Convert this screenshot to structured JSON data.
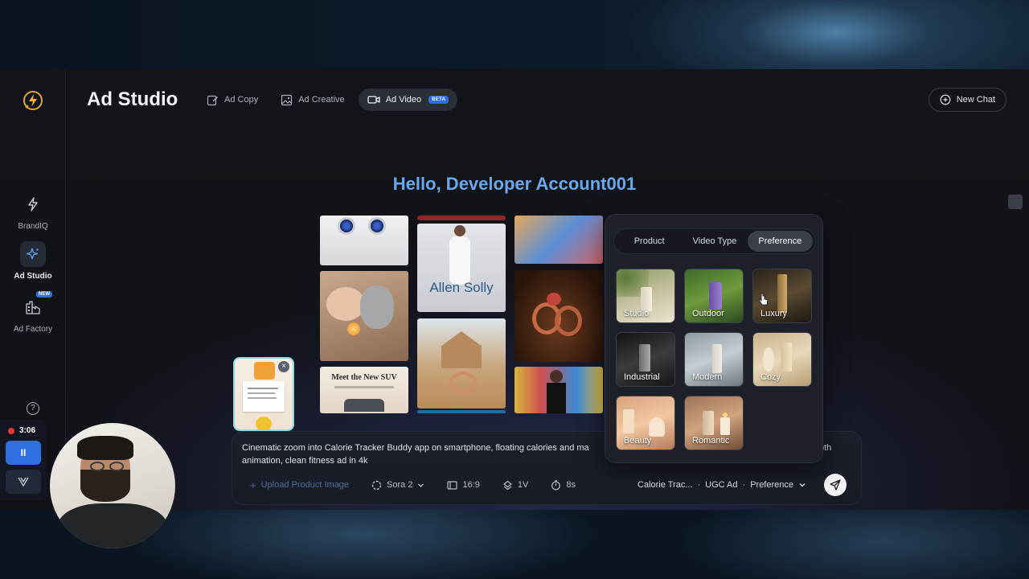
{
  "app": {
    "title": "Ad Studio",
    "new_chat_label": "New Chat"
  },
  "sidebar": {
    "items": [
      {
        "label": "BrandIQ",
        "icon": "bolt-icon"
      },
      {
        "label": "Ad Studio",
        "icon": "sparkle-icon",
        "active": true
      },
      {
        "label": "Ad Factory",
        "icon": "factory-icon",
        "badge": "NEW"
      }
    ],
    "help_icon": "?"
  },
  "tabs": [
    {
      "label": "Ad Copy",
      "icon": "edit-icon"
    },
    {
      "label": "Ad Creative",
      "icon": "image-icon"
    },
    {
      "label": "Ad Video",
      "icon": "video-icon",
      "badge": "BETA",
      "active": true
    }
  ],
  "greeting": "Hello, Developer Account001",
  "gallery": {
    "allen_solly": "Allen Solly",
    "suv_title": "Meet the New SUV"
  },
  "prompt": {
    "text_line1": "Cinematic zoom into Calorie Tracker Buddy app on smartphone, floating calories and ma",
    "text_line1_tail": "oth",
    "text_line2": "animation, clean fitness ad in 4k",
    "upload_label": "Upload Product Image",
    "model": "Sora 2",
    "aspect": "16:9",
    "count": "1V",
    "duration": "8s",
    "summary_product": "Calorie Trac...",
    "summary_type": "UGC Ad",
    "summary_pref": "Preference",
    "separator": "·"
  },
  "popup": {
    "tabs": [
      {
        "label": "Product"
      },
      {
        "label": "Video Type"
      },
      {
        "label": "Preference",
        "active": true
      }
    ],
    "options": [
      {
        "label": "Studio"
      },
      {
        "label": "Outdoor"
      },
      {
        "label": "Luxury"
      },
      {
        "label": "Industrial"
      },
      {
        "label": "Modern"
      },
      {
        "label": "Cozy"
      },
      {
        "label": "Beauty"
      },
      {
        "label": "Romantic"
      }
    ]
  },
  "recording": {
    "time": "3:06",
    "pause": "II"
  },
  "colors": {
    "accent_blue": "#2f6fe0",
    "greeting": "#6aa8ee",
    "record_red": "#e53935"
  }
}
